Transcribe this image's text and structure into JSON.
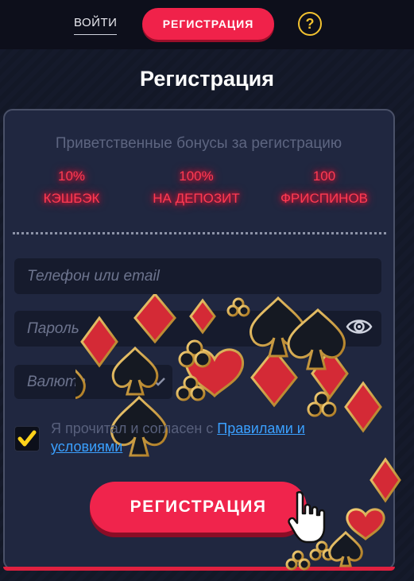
{
  "header": {
    "login_label": "ВОЙТИ",
    "register_label": "РЕГИСТРАЦИЯ",
    "help_symbol": "?"
  },
  "page": {
    "title": "Регистрация"
  },
  "bonuses": {
    "title": "Приветственные бонусы за регистрацию",
    "items": [
      {
        "value": "10%",
        "label": "КЭШБЭК"
      },
      {
        "value": "100%",
        "label": "НА ДЕПОЗИТ"
      },
      {
        "value": "100",
        "label": "ФРИСПИНОВ"
      }
    ]
  },
  "form": {
    "contact_placeholder": "Телефон или email",
    "password_placeholder": "Пароль",
    "currency_placeholder": "Валюта",
    "agree_text": "Я прочитал и согласен с ",
    "agree_link": "Правилами и условиями",
    "checkbox_checked": true,
    "submit_label": "РЕГИСТРАЦИЯ"
  },
  "colors": {
    "accent": "#f0224a",
    "help": "#f2c230",
    "neon": "#ff3a52",
    "link": "#3aa0ff"
  },
  "icons": [
    "help-icon",
    "eye-icon",
    "chevron-down-icon",
    "check-icon",
    "hand-cursor-icon",
    "card-suit-decor"
  ]
}
